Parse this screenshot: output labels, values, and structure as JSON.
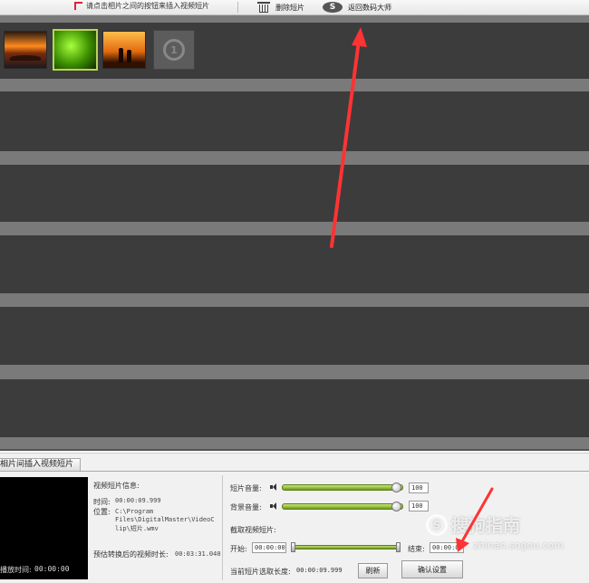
{
  "toolbar": {
    "hint": "请点击相片之间的按钮来插入视频短片",
    "delete_clip": "删除短片",
    "back_to_master": "返回数码大师",
    "s_glyph": "S"
  },
  "timeline": {
    "placeholder_glyph": "1"
  },
  "panel": {
    "tab_label": "相片间插入视频短片",
    "playback_label": "播放时间:",
    "playback_time": "00:00:00",
    "info_title": "视频短片信息:",
    "time_label": "时间:",
    "time_value": "00:00:09.999",
    "location_label": "位置:",
    "location_lines": [
      "C:\\Program",
      "Files\\DigitalMaster\\VideoC",
      "lip\\短片.wmv"
    ],
    "estimated_label": "预估转换后的视频时长:",
    "estimated_value": "00:03:31.040",
    "clip_volume_label": "短片音量:",
    "clip_volume_value": "100",
    "bg_volume_label": "背景音量:",
    "bg_volume_value": "100",
    "capture_label": "截取视频短片:",
    "start_label": "开始:",
    "start_value": "00:00:00",
    "end_label": "结束:",
    "end_value": "00:00:09",
    "current_length_label": "当前短片选取长度:",
    "current_length_value": "00:00:09.999",
    "refresh_button": "刷新",
    "confirm_button": "确认设置"
  },
  "watermark": {
    "logo_glyph": "S",
    "name": "搜狗指南",
    "url": "zhinan.sogou.com"
  },
  "colors": {
    "timeline_band": "#3c3c3c",
    "timeline_strip": "#7a7a7a",
    "slider_green": "#8ab83a",
    "selection_border": "#b9d45a",
    "annotation_arrow": "#ff3333"
  }
}
